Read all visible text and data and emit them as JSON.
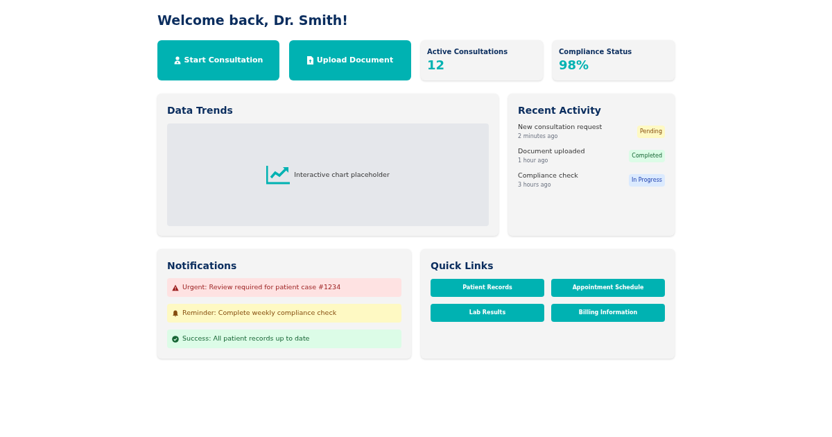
{
  "title": "Welcome back, Dr. Smith!",
  "actions": [
    {
      "label": "Start Consultation",
      "kind": "consult"
    },
    {
      "label": "Upload Document",
      "kind": "upload"
    }
  ],
  "stats": [
    {
      "label": "Active Consultations",
      "value": "12"
    },
    {
      "label": "Compliance Status",
      "value": "98%"
    }
  ],
  "data_trends": {
    "title": "Data Trends",
    "placeholder_text": "Interactive chart placeholder"
  },
  "recent_activity": {
    "title": "Recent Activity",
    "items": [
      {
        "text": "New consultation request",
        "time": "2 minutes ago",
        "status": "Pending",
        "kind": "pending"
      },
      {
        "text": "Document uploaded",
        "time": "1 hour ago",
        "status": "Completed",
        "kind": "completed"
      },
      {
        "text": "Compliance check",
        "time": "3 hours ago",
        "status": "In Progress",
        "kind": "in_progress"
      }
    ]
  },
  "notifications": {
    "title": "Notifications",
    "items": [
      {
        "text": "Urgent: Review required for patient case #1234",
        "kind": "urgent"
      },
      {
        "text": "Reminder: Complete weekly compliance check",
        "kind": "reminder"
      },
      {
        "text": "Success: All patient records up to date",
        "kind": "success"
      }
    ]
  },
  "quick_links": {
    "title": "Quick Links",
    "items": [
      "Patient Records",
      "Appointment Schedule",
      "Lab Results",
      "Billing Information"
    ]
  }
}
